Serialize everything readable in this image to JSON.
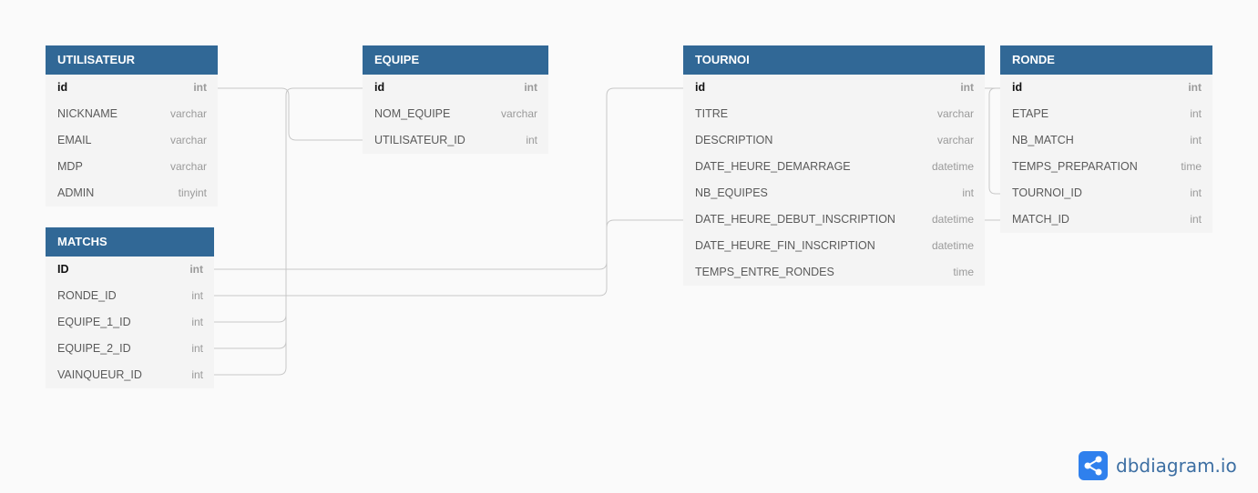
{
  "tables": [
    {
      "key": "utilisateur",
      "name": "UTILISATEUR",
      "fields": [
        {
          "name": "id",
          "type": "int",
          "pk": true
        },
        {
          "name": "NICKNAME",
          "type": "varchar",
          "pk": false
        },
        {
          "name": "EMAIL",
          "type": "varchar",
          "pk": false
        },
        {
          "name": "MDP",
          "type": "varchar",
          "pk": false
        },
        {
          "name": "ADMIN",
          "type": "tinyint",
          "pk": false
        }
      ]
    },
    {
      "key": "matchs",
      "name": "MATCHS",
      "fields": [
        {
          "name": "ID",
          "type": "int",
          "pk": true
        },
        {
          "name": "RONDE_ID",
          "type": "int",
          "pk": false
        },
        {
          "name": "EQUIPE_1_ID",
          "type": "int",
          "pk": false
        },
        {
          "name": "EQUIPE_2_ID",
          "type": "int",
          "pk": false
        },
        {
          "name": "VAINQUEUR_ID",
          "type": "int",
          "pk": false
        }
      ]
    },
    {
      "key": "equipe",
      "name": "EQUIPE",
      "fields": [
        {
          "name": "id",
          "type": "int",
          "pk": true
        },
        {
          "name": "NOM_EQUIPE",
          "type": "varchar",
          "pk": false
        },
        {
          "name": "UTILISATEUR_ID",
          "type": "int",
          "pk": false
        }
      ]
    },
    {
      "key": "tournoi",
      "name": "TOURNOI",
      "fields": [
        {
          "name": "id",
          "type": "int",
          "pk": true
        },
        {
          "name": "TITRE",
          "type": "varchar",
          "pk": false
        },
        {
          "name": "DESCRIPTION",
          "type": "varchar",
          "pk": false
        },
        {
          "name": "DATE_HEURE_DEMARRAGE",
          "type": "datetime",
          "pk": false
        },
        {
          "name": "NB_EQUIPES",
          "type": "int",
          "pk": false
        },
        {
          "name": "DATE_HEURE_DEBUT_INSCRIPTION",
          "type": "datetime",
          "pk": false
        },
        {
          "name": "DATE_HEURE_FIN_INSCRIPTION",
          "type": "datetime",
          "pk": false
        },
        {
          "name": "TEMPS_ENTRE_RONDES",
          "type": "time",
          "pk": false
        }
      ]
    },
    {
      "key": "ronde",
      "name": "RONDE",
      "fields": [
        {
          "name": "id",
          "type": "int",
          "pk": true
        },
        {
          "name": "ETAPE",
          "type": "int",
          "pk": false
        },
        {
          "name": "NB_MATCH",
          "type": "int",
          "pk": false
        },
        {
          "name": "TEMPS_PREPARATION",
          "type": "time",
          "pk": false
        },
        {
          "name": "TOURNOI_ID",
          "type": "int",
          "pk": false
        },
        {
          "name": "MATCH_ID",
          "type": "int",
          "pk": false
        }
      ]
    }
  ],
  "relationships": [
    {
      "from": "UTILISATEUR.id",
      "to": "EQUIPE.UTILISATEUR_ID"
    },
    {
      "from": "MATCHS.EQUIPE_1_ID",
      "to": "EQUIPE.id"
    },
    {
      "from": "MATCHS.EQUIPE_2_ID",
      "to": "EQUIPE.id"
    },
    {
      "from": "MATCHS.VAINQUEUR_ID",
      "to": "EQUIPE.id"
    },
    {
      "from": "MATCHS.ID",
      "to": "TOURNOI.id"
    },
    {
      "from": "MATCHS.RONDE_ID",
      "to": "TOURNOI.DATE_HEURE_DEBUT_INSCRIPTION"
    },
    {
      "from": "TOURNOI.id",
      "to": "RONDE.TOURNOI_ID"
    },
    {
      "from": "TOURNOI.DATE_HEURE_DEBUT_INSCRIPTION",
      "to": "RONDE.MATCH_ID"
    }
  ],
  "brand": {
    "text": "dbdiagram.io",
    "logo_icon": "share-nodes-icon"
  },
  "colors": {
    "header": "#316896",
    "table_body": "#f4f4f4",
    "connector": "#c8c8c8",
    "background": "#fafafa",
    "brand": "#2f80ed"
  }
}
